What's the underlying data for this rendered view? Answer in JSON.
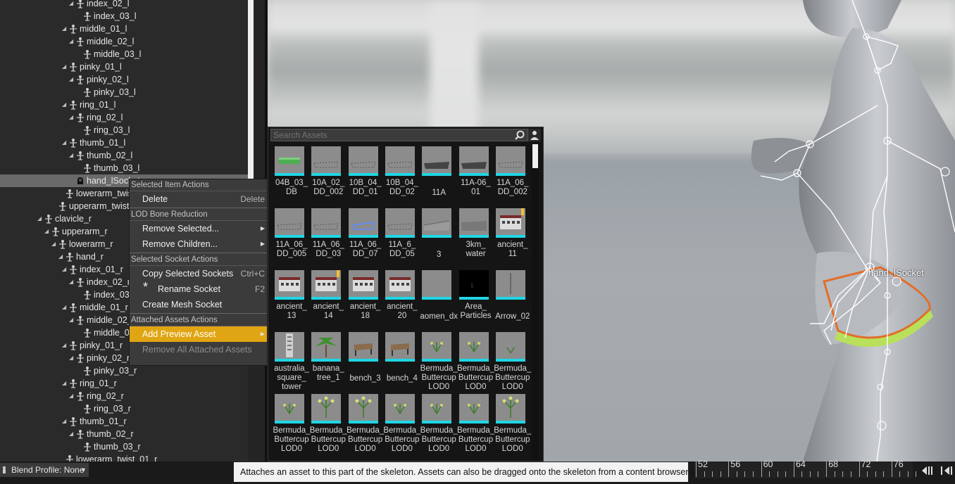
{
  "tree": {
    "rows": [
      {
        "label": "index_02_l",
        "indent": 3,
        "arrow": true
      },
      {
        "label": "index_03_l",
        "indent": 4,
        "arrow": false
      },
      {
        "label": "middle_01_l",
        "indent": 2,
        "arrow": true
      },
      {
        "label": "middle_02_l",
        "indent": 3,
        "arrow": true
      },
      {
        "label": "middle_03_l",
        "indent": 4,
        "arrow": false
      },
      {
        "label": "pinky_01_l",
        "indent": 2,
        "arrow": true
      },
      {
        "label": "pinky_02_l",
        "indent": 3,
        "arrow": true
      },
      {
        "label": "pinky_03_l",
        "indent": 4,
        "arrow": false
      },
      {
        "label": "ring_01_l",
        "indent": 2,
        "arrow": true
      },
      {
        "label": "ring_02_l",
        "indent": 3,
        "arrow": true
      },
      {
        "label": "ring_03_l",
        "indent": 4,
        "arrow": false
      },
      {
        "label": "thumb_01_l",
        "indent": 2,
        "arrow": true
      },
      {
        "label": "thumb_02_l",
        "indent": 3,
        "arrow": true
      },
      {
        "label": "thumb_03_l",
        "indent": 4,
        "arrow": false
      },
      {
        "label": "hand_lSocket",
        "indent": 3,
        "arrow": false,
        "socket": true,
        "selected": true
      },
      {
        "label": "lowerarm_twist",
        "indent": 1.5,
        "arrow": false
      },
      {
        "label": "upperarm_twist",
        "indent": 0.5,
        "arrow": false
      },
      {
        "label": "clavicle_r",
        "indent": -1.5,
        "arrow": true
      },
      {
        "label": "upperarm_r",
        "indent": -0.5,
        "arrow": true
      },
      {
        "label": "lowerarm_r",
        "indent": 0.5,
        "arrow": true
      },
      {
        "label": "hand_r",
        "indent": 1.5,
        "arrow": true
      },
      {
        "label": "index_01_r",
        "indent": 2,
        "arrow": true
      },
      {
        "label": "index_02_r",
        "indent": 3,
        "arrow": true
      },
      {
        "label": "index_03_r",
        "indent": 4,
        "arrow": false
      },
      {
        "label": "middle_01_r",
        "indent": 2,
        "arrow": true
      },
      {
        "label": "middle_02_r",
        "indent": 3,
        "arrow": true
      },
      {
        "label": "middle_03_r",
        "indent": 4,
        "arrow": false
      },
      {
        "label": "pinky_01_r",
        "indent": 2,
        "arrow": true
      },
      {
        "label": "pinky_02_r",
        "indent": 3,
        "arrow": true
      },
      {
        "label": "pinky_03_r",
        "indent": 4,
        "arrow": false
      },
      {
        "label": "ring_01_r",
        "indent": 2,
        "arrow": true
      },
      {
        "label": "ring_02_r",
        "indent": 3,
        "arrow": true
      },
      {
        "label": "ring_03_r",
        "indent": 4,
        "arrow": false
      },
      {
        "label": "thumb_01_r",
        "indent": 2,
        "arrow": true
      },
      {
        "label": "thumb_02_r",
        "indent": 3,
        "arrow": true
      },
      {
        "label": "thumb_03_r",
        "indent": 4,
        "arrow": false
      },
      {
        "label": "lowerarm_twist_01_r",
        "indent": 1.5,
        "arrow": false
      }
    ]
  },
  "viewport": {
    "socket_label": "hand_lSocket"
  },
  "picker": {
    "search_placeholder": "Search Assets",
    "assets": [
      {
        "name": "04B_03_\nDB",
        "thumb": "green-slab"
      },
      {
        "name": "10A_02_\nDD_002",
        "thumb": "grey-outline"
      },
      {
        "name": "10B_04_\nDD_01",
        "thumb": "grey-outline"
      },
      {
        "name": "10B_04_\nDD_02",
        "thumb": "grey-outline"
      },
      {
        "name": "11A",
        "thumb": "dark-slab"
      },
      {
        "name": "11A-06_\n01",
        "thumb": "dark-slab"
      },
      {
        "name": "11A_06_\nDD_002",
        "thumb": "grey-outline"
      },
      {
        "name": "11A_06_\nDD_005",
        "thumb": "grey-outline"
      },
      {
        "name": "11A_06_\nDD_03",
        "thumb": "grey-outline"
      },
      {
        "name": "11A_06_\nDD_07",
        "thumb": "blue-outline"
      },
      {
        "name": "11A_6_\nDD_05",
        "thumb": "grey-outline"
      },
      {
        "name": "3",
        "thumb": "terrain"
      },
      {
        "name": "3km_\nwater",
        "thumb": "water"
      },
      {
        "name": "ancient_\n11",
        "thumb": "building",
        "warn": true
      },
      {
        "name": "ancient_\n13",
        "thumb": "building"
      },
      {
        "name": "ancient_\n14",
        "thumb": "building",
        "warn": true
      },
      {
        "name": "ancient_\n18",
        "thumb": "building"
      },
      {
        "name": "ancient_\n20",
        "thumb": "building"
      },
      {
        "name": "aomen_dx",
        "thumb": "empty"
      },
      {
        "name": "Area_\nParticles",
        "thumb": "black"
      },
      {
        "name": "Arrow_02",
        "thumb": "pole"
      },
      {
        "name": "australia_\nsquare_\ntower",
        "thumb": "tower"
      },
      {
        "name": "banana_\ntree_1",
        "thumb": "tree"
      },
      {
        "name": "bench_3",
        "thumb": "bench"
      },
      {
        "name": "bench_4",
        "thumb": "bench"
      },
      {
        "name": "Bermuda_\nButtercup\nLOD0",
        "thumb": "plant"
      },
      {
        "name": "Bermuda_\nButtercup\nLOD0",
        "thumb": "plant"
      },
      {
        "name": "Bermuda_\nButtercup\nLOD0",
        "thumb": "plant-small"
      },
      {
        "name": "Bermuda_\nButtercup\nLOD0",
        "thumb": "plant"
      },
      {
        "name": "Bermuda_\nButtercup\nLOD0",
        "thumb": "plant-tall"
      },
      {
        "name": "Bermuda_\nButtercup\nLOD0",
        "thumb": "plant-tall"
      },
      {
        "name": "Bermuda_\nButtercup\nLOD0",
        "thumb": "plant"
      },
      {
        "name": "Bermuda_\nButtercup\nLOD0",
        "thumb": "plant"
      },
      {
        "name": "Bermuda_\nButtercup\nLOD0",
        "thumb": "plant"
      },
      {
        "name": "Bermuda_\nButtercup\nLOD0",
        "thumb": "plant-tall"
      }
    ]
  },
  "menu": {
    "sections": [
      {
        "header": "Selected Item Actions",
        "items": [
          {
            "label": "Delete",
            "shortcut": "Delete"
          }
        ]
      },
      {
        "header": "LOD Bone Reduction",
        "items": [
          {
            "label": "Remove Selected...",
            "submenu": true
          },
          {
            "label": "Remove Children...",
            "submenu": true
          }
        ]
      },
      {
        "header": "Selected Socket Actions",
        "items": [
          {
            "label": "Copy Selected Sockets",
            "shortcut": "Ctrl+C"
          },
          {
            "label": "Rename Socket",
            "shortcut": "F2",
            "icon": "asterisk-icon"
          },
          {
            "label": "Create Mesh Socket"
          }
        ]
      },
      {
        "header": "Attached Assets Actions",
        "items": [
          {
            "label": "Add Preview Asset",
            "submenu": true,
            "active": true
          },
          {
            "label": "Remove All Attached Assets",
            "disabled": true
          }
        ]
      }
    ]
  },
  "bottom": {
    "blend_profile": "Blend Profile: None",
    "tooltip": "Attaches an asset to this part of the skeleton. Assets can also be dragged onto the skeleton from a content browser to attach",
    "timeline_ticks": [
      "52",
      "56",
      "60",
      "64",
      "68",
      "72",
      "76"
    ]
  },
  "colors": {
    "menu_highlight": "#e0a512",
    "thumb_underline": "#1fd6e3",
    "selection_row": "#6a6a6a"
  }
}
